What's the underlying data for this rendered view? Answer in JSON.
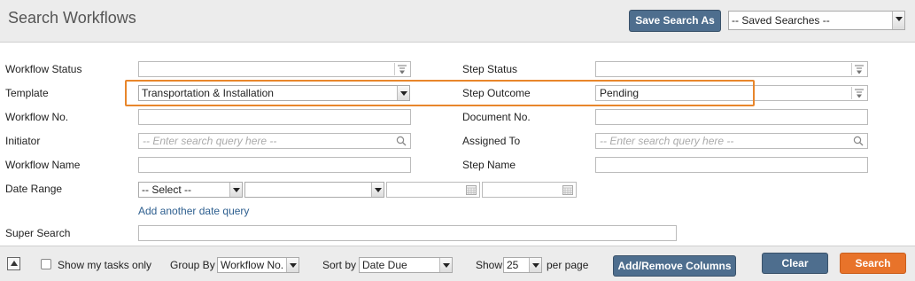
{
  "header": {
    "title": "Search Workflows",
    "save_search_label": "Save Search As",
    "saved_searches_value": "-- Saved Searches --"
  },
  "form": {
    "workflow_status": {
      "label": "Workflow Status",
      "value": ""
    },
    "template": {
      "label": "Template",
      "value": "Transportation & Installation"
    },
    "workflow_no": {
      "label": "Workflow No.",
      "value": ""
    },
    "initiator": {
      "label": "Initiator",
      "placeholder": "-- Enter search query here --"
    },
    "workflow_name": {
      "label": "Workflow Name",
      "value": ""
    },
    "date_range": {
      "label": "Date Range",
      "select_value": "-- Select --",
      "add_link": "Add another date query"
    },
    "super_search": {
      "label": "Super Search",
      "value": ""
    },
    "step_status": {
      "label": "Step Status",
      "value": ""
    },
    "step_outcome": {
      "label": "Step Outcome",
      "value": "Pending"
    },
    "document_no": {
      "label": "Document No.",
      "value": ""
    },
    "assigned_to": {
      "label": "Assigned To",
      "placeholder": "-- Enter search query here --"
    },
    "step_name": {
      "label": "Step Name",
      "value": ""
    }
  },
  "footer": {
    "show_my_tasks_label": "Show my tasks only",
    "show_my_tasks_checked": false,
    "group_by_label": "Group By",
    "group_by_value": "Workflow No.",
    "sort_by_label": "Sort by",
    "sort_by_value": "Date Due",
    "show_label": "Show",
    "show_value": "25",
    "per_page_label": "per page",
    "add_remove_columns_label": "Add/Remove Columns",
    "clear_label": "Clear",
    "search_label": "Search"
  },
  "colors": {
    "accent_blue": "#4e6e8e",
    "accent_orange": "#e8732a",
    "highlight": "#e8862b",
    "link": "#2e5f8f"
  },
  "icons": [
    "combo-filter-icon",
    "magnifier-icon",
    "calendar-icon",
    "dropdown-arrow-icon",
    "collapse-up-icon"
  ]
}
